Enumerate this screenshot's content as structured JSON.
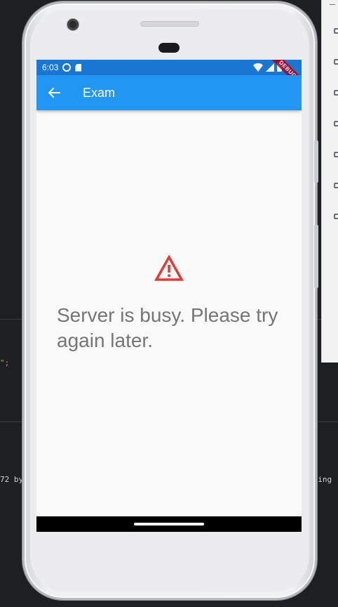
{
  "ide": {
    "snippet_quote": "\";",
    "snippet_left": "72 by",
    "snippet_right": "lding"
  },
  "status_bar": {
    "time": "6:03",
    "debug_label": "DEBUG"
  },
  "app_bar": {
    "title": "Exam",
    "back_icon": "arrow-back-icon"
  },
  "content": {
    "icon": "warning-icon",
    "icon_color": "#e53935",
    "message": "Server is busy. Please try again later."
  },
  "colors": {
    "status_bar": "#1976d2",
    "app_bar": "#2196f3",
    "message_text": "#757575"
  }
}
